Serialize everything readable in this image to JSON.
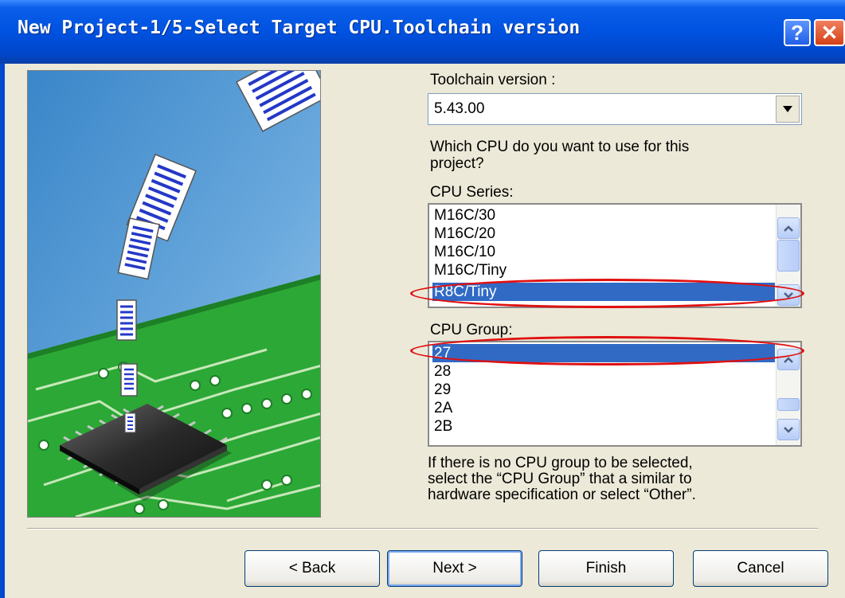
{
  "window": {
    "title": "New Project-1/5-Select Target CPU.Toolchain version",
    "help_glyph": "?",
    "close_glyph": "✕"
  },
  "toolchain": {
    "label": "Toolchain version :",
    "value": "5.43.00"
  },
  "question": {
    "line1": "Which CPU do you want to use for this",
    "line2": "project?"
  },
  "cpu_series": {
    "label": "CPU Series:",
    "items": [
      "M16C/30",
      "M16C/20",
      "M16C/10",
      "M16C/Tiny",
      "R8C/Tiny"
    ],
    "selected": "R8C/Tiny"
  },
  "cpu_group": {
    "label": "CPU Group:",
    "items": [
      "27",
      "28",
      "29",
      "2A",
      "2B"
    ],
    "selected": "27"
  },
  "help": {
    "line1": "If there is no CPU group to be selected,",
    "line2": "select the “CPU Group” that a similar to",
    "line3": "hardware specification or select “Other”."
  },
  "buttons": {
    "back": "< Back",
    "next": "Next >",
    "finish": "Finish",
    "cancel": "Cancel"
  },
  "colors": {
    "title_bar": "#0052e0",
    "selection": "#316ac5",
    "annotation": "#e01010",
    "pcb_green": "#2ca836"
  }
}
